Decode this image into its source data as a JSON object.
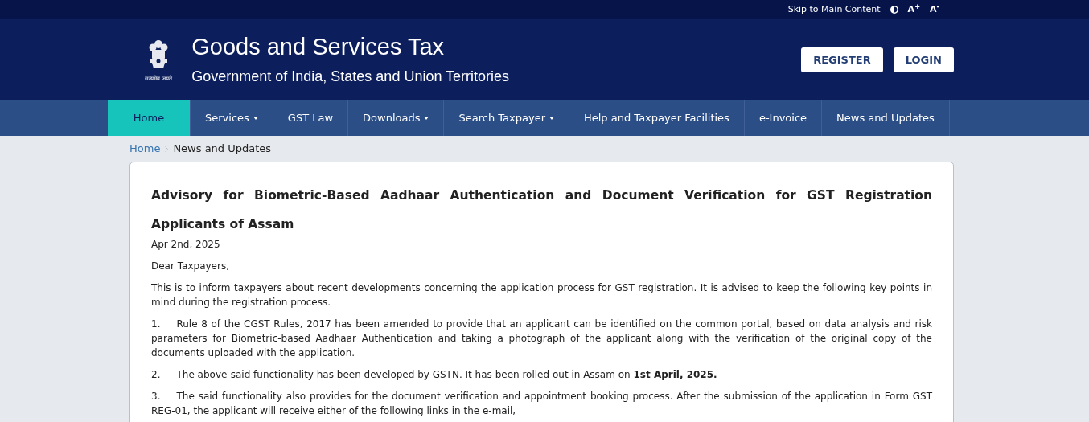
{
  "top_bar": {
    "skip_link": "Skip to Main Content",
    "font_increase": "A",
    "font_increase_mark": "+",
    "font_decrease": "A",
    "font_decrease_mark": "-"
  },
  "header": {
    "emblem_motto": "सत्यमेव जयते",
    "title": "Goods and Services Tax",
    "subtitle": "Government of India, States and Union Territories",
    "buttons": [
      "REGISTER",
      "LOGIN"
    ]
  },
  "nav": [
    {
      "label": "Home",
      "selected": true,
      "dropdown": false
    },
    {
      "label": "Services",
      "selected": false,
      "dropdown": true
    },
    {
      "label": "GST Law",
      "selected": false,
      "dropdown": false
    },
    {
      "label": "Downloads",
      "selected": false,
      "dropdown": true
    },
    {
      "label": "Search Taxpayer",
      "selected": false,
      "dropdown": true
    },
    {
      "label": "Help and Taxpayer Facilities",
      "selected": false,
      "dropdown": false
    },
    {
      "label": "e-Invoice",
      "selected": false,
      "dropdown": false
    },
    {
      "label": "News and Updates",
      "selected": false,
      "dropdown": false
    }
  ],
  "breadcrumb": [
    "Home",
    "News and Updates"
  ],
  "article": {
    "title": "Advisory for Biometric-Based Aadhaar Authentication and Document Verification for GST Registration Applicants of Assam",
    "date": "Apr 2nd, 2025",
    "greeting": "Dear Taxpayers,",
    "intro": "This is to inform taxpayers about recent developments concerning the application process for GST registration. It is advised to keep the following key points in mind during the registration process.",
    "points": [
      {
        "number": "1.",
        "text": "Rule 8 of the CGST Rules, 2017 has been amended to provide that an applicant can be identified on the common portal, based on data analysis and risk parameters for Biometric-based Aadhaar Authentication and taking a photograph of the applicant along with the verification of the original copy of the documents uploaded with the application."
      },
      {
        "number": "2.",
        "text": "The above-said functionality has been developed by GSTN. It has been rolled out in Assam on **1st April, 2025.**"
      },
      {
        "number": "3.",
        "text": "The said functionality also provides for the document verification and appointment booking process. After the submission of the application in Form GST REG-01, the applicant will receive either of the following links in the e-mail,"
      }
    ]
  }
}
